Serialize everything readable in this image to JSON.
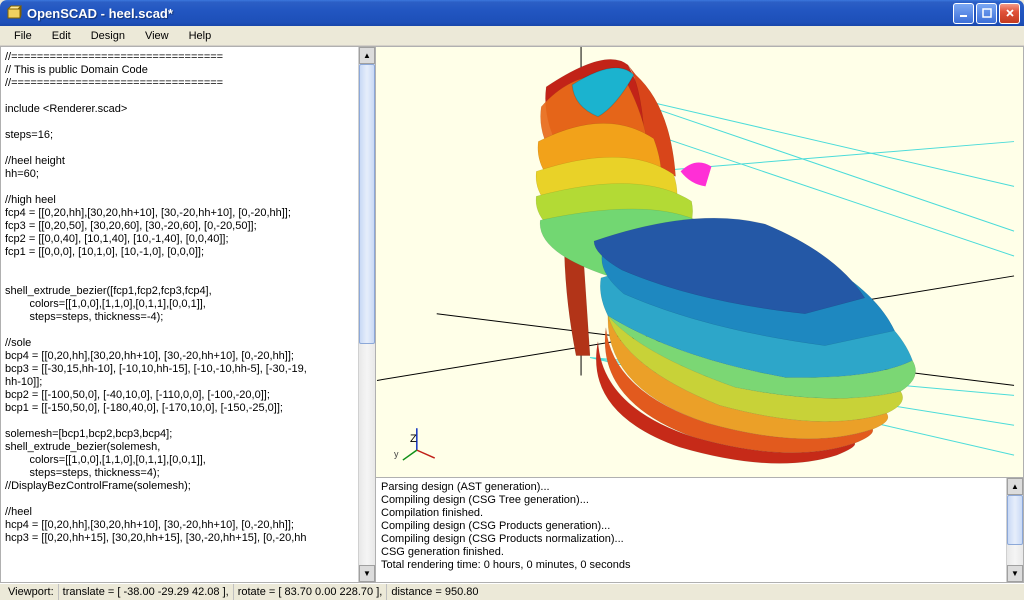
{
  "title": "OpenSCAD - heel.scad*",
  "menu": [
    "File",
    "Edit",
    "Design",
    "View",
    "Help"
  ],
  "code": "//=================================\n// This is public Domain Code\n//=================================\n\ninclude <Renderer.scad>\n\nsteps=16;\n\n//heel height\nhh=60;\n\n//high heel\nfcp4 = [[0,20,hh],[30,20,hh+10], [30,-20,hh+10], [0,-20,hh]];\nfcp3 = [[0,20,50], [30,20,60], [30,-20,60], [0,-20,50]];\nfcp2 = [[0,0,40], [10,1,40], [10,-1,40], [0,0,40]];\nfcp1 = [[0,0,0], [10,1,0], [10,-1,0], [0,0,0]];\n\n\nshell_extrude_bezier([fcp1,fcp2,fcp3,fcp4],\n        colors=[[1,0,0],[1,1,0],[0,1,1],[0,0,1]],\n        steps=steps, thickness=-4);\n\n//sole\nbcp4 = [[0,20,hh],[30,20,hh+10], [30,-20,hh+10], [0,-20,hh]];\nbcp3 = [[-30,15,hh-10], [-10,10,hh-15], [-10,-10,hh-5], [-30,-19,\nhh-10]];\nbcp2 = [[-100,50,0], [-40,10,0], [-110,0,0], [-100,-20,0]];\nbcp1 = [[-150,50,0], [-180,40,0], [-170,10,0], [-150,-25,0]];\n\nsolemesh=[bcp1,bcp2,bcp3,bcp4];\nshell_extrude_bezier(solemesh,\n        colors=[[1,0,0],[1,1,0],[0,1,1],[0,0,1]],\n        steps=steps, thickness=4);\n//DisplayBezControlFrame(solemesh);\n\n//heel\nhcp4 = [[0,20,hh],[30,20,hh+10], [30,-20,hh+10], [0,-20,hh]];\nhcp3 = [[0,20,hh+15], [30,20,hh+15], [30,-20,hh+15], [0,-20,hh",
  "axis_label_z": "Z",
  "axis_label_y": "y",
  "console_log": "Parsing design (AST generation)...\nCompiling design (CSG Tree generation)...\nCompilation finished.\nCompiling design (CSG Products generation)...\nCompiling design (CSG Products normalization)...\nCSG generation finished.\nTotal rendering time: 0 hours, 0 minutes, 0 seconds",
  "status": {
    "viewport": "Viewport:",
    "translate": "translate = [ -38.00 -29.29 42.08 ],",
    "rotate": "rotate = [ 83.70 0.00 228.70 ],",
    "distance": "distance = 950.80"
  }
}
